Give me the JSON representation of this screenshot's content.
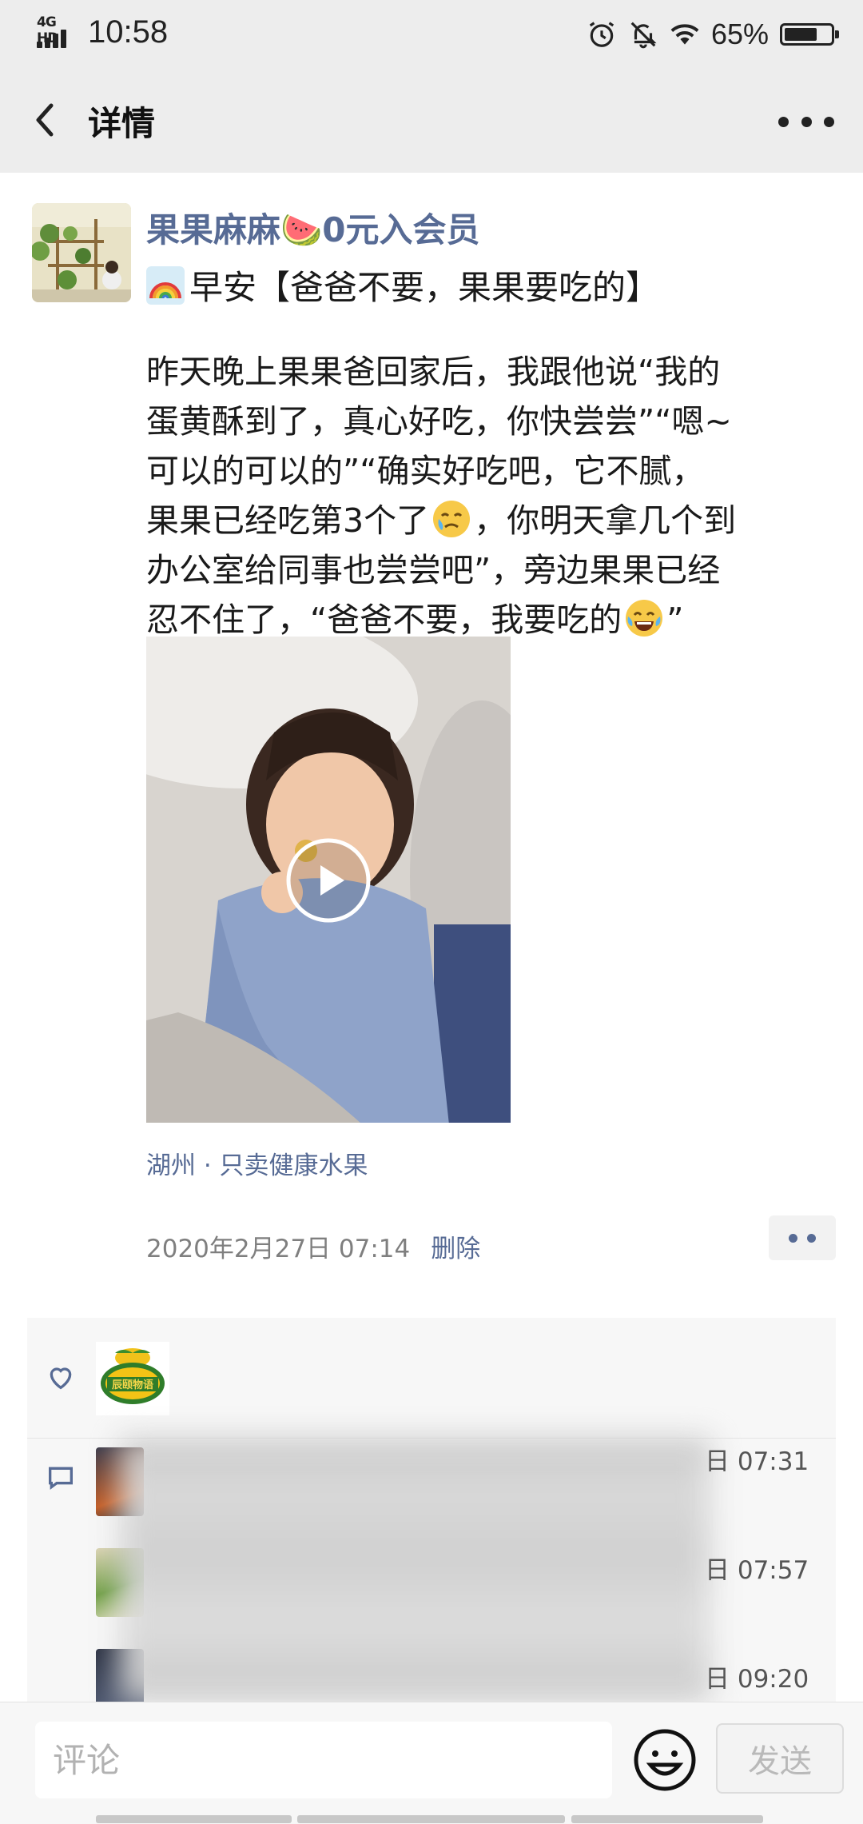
{
  "status_bar": {
    "network": "4G HD",
    "time": "10:58",
    "battery_percent": "65%",
    "battery_level": 0.65,
    "icons": [
      "alarm-icon",
      "mute-icon",
      "wifi-icon",
      "battery-icon"
    ]
  },
  "nav": {
    "title": "详情",
    "back_icon": "chevron-left-icon",
    "more_icon": "more-icon"
  },
  "post": {
    "author": "果果麻麻🍉0元入会员",
    "title_emoji_icon": "rainbow-icon",
    "title": "早安【爸爸不要，果果要吃的】",
    "body_lines": [
      "昨天晚上果果爸回家后，我跟他说“我的",
      "蛋黄酥到了，真心好吃，你快尝尝”“嗯~",
      "可以的可以的”“确实好吃吧，它不腻，"
    ],
    "line4_pre": "果果已经吃第3个了",
    "line4_post": "，你明天拿几个到",
    "line5": "办公室给同事也尝尝吧”，旁边果果已经",
    "line6_pre": "忍不住了，“爸爸不要，我要吃的",
    "line6_post": "”",
    "location": "湖州 · 只卖健康水果",
    "timestamp": "2020年2月27日 07:14",
    "delete_label": "删除"
  },
  "interactions": {
    "like_icon": "heart-icon",
    "comment_icon": "comment-icon",
    "like_avatar_text": "辰颐物语",
    "comments": [
      {
        "time": "日 07:31"
      },
      {
        "time": "日 07:57"
      },
      {
        "time": "日 09:20"
      }
    ]
  },
  "input_bar": {
    "placeholder": "评论",
    "send_label": "发送",
    "emoji_icon": "smile-icon"
  },
  "colors": {
    "link": "#576b95",
    "header_bg": "#ededed",
    "panel_bg": "#f7f7f7"
  }
}
